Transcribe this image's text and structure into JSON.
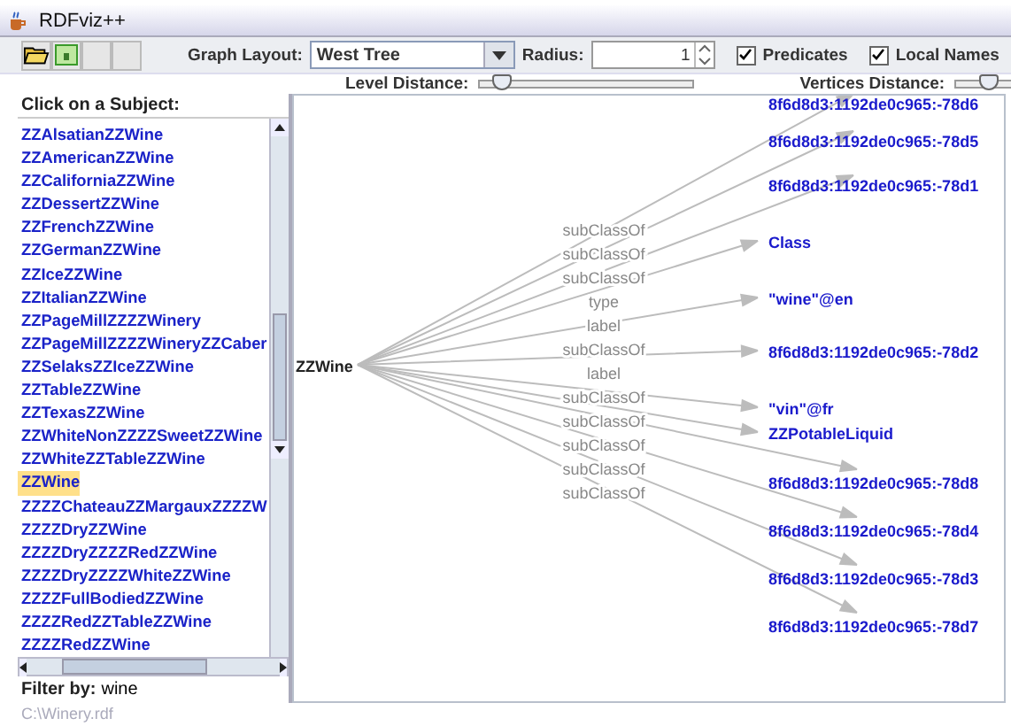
{
  "window": {
    "title": "RDFviz++"
  },
  "toolbar": {
    "graph_layout_label": "Graph Layout:",
    "graph_layout": "West Tree",
    "radius_label": "Radius:",
    "radius": "1",
    "options": [
      {
        "label": "Predicates",
        "checked": true
      },
      {
        "label": "Local Names",
        "checked": true
      }
    ]
  },
  "sliders": [
    {
      "label": "Level Distance:",
      "level": 0.1
    },
    {
      "label": "Vertices Distance:",
      "level": 0.15
    }
  ],
  "subjects": {
    "heading": "Click on a Subject:",
    "items": [
      {
        "label": "ZZAlsatianZZWine",
        "selected": false
      },
      {
        "label": "ZZAmericanZZWine",
        "selected": false
      },
      {
        "label": "ZZCaliforniaZZWine",
        "selected": false
      },
      {
        "label": "ZZDessertZZWine",
        "selected": false
      },
      {
        "label": "ZZFrenchZZWine",
        "selected": false
      },
      {
        "label": "ZZGermanZZWine",
        "selected": false
      },
      {
        "label": "ZZIceZZWine",
        "selected": false
      },
      {
        "label": "ZZItalianZZWine",
        "selected": false
      },
      {
        "label": "ZZPageMillZZZZWinery",
        "selected": false
      },
      {
        "label": "ZZPageMillZZZZWineryZZCaber",
        "selected": false
      },
      {
        "label": "ZZSelaksZZIceZZWine",
        "selected": false
      },
      {
        "label": "ZZTableZZWine",
        "selected": false
      },
      {
        "label": "ZZTexasZZWine",
        "selected": false
      },
      {
        "label": "ZZWhiteNonZZZZSweetZZWine",
        "selected": false
      },
      {
        "label": "ZZWhiteZZTableZZWine",
        "selected": false
      },
      {
        "label": "ZZWine",
        "selected": true
      },
      {
        "label": "ZZZZChateauZZMargauxZZZZW",
        "selected": false
      },
      {
        "label": "ZZZZDryZZWine",
        "selected": false
      },
      {
        "label": "ZZZZDryZZZZRedZZWine",
        "selected": false
      },
      {
        "label": "ZZZZDryZZZZWhiteZZWine",
        "selected": false
      },
      {
        "label": "ZZZZFullBodiedZZWine",
        "selected": false
      },
      {
        "label": "ZZZZRedZZTableZZWine",
        "selected": false
      },
      {
        "label": "ZZZZRedZZWine",
        "selected": false
      }
    ],
    "filter_label": "Filter by:",
    "filter": "wine"
  },
  "graph": {
    "root": "ZZWine",
    "edges": [
      {
        "predicate": "subClassOf",
        "object": "8f6d8d3:1192de0c965:-78d6"
      },
      {
        "predicate": "subClassOf",
        "object": "8f6d8d3:1192de0c965:-78d5"
      },
      {
        "predicate": "subClassOf",
        "object": "8f6d8d3:1192de0c965:-78d1"
      },
      {
        "predicate": "type",
        "object": "Class"
      },
      {
        "predicate": "label",
        "object": "\"wine\"@en"
      },
      {
        "predicate": "subClassOf",
        "object": "8f6d8d3:1192de0c965:-78d2"
      },
      {
        "predicate": "label",
        "object": "\"vin\"@fr"
      },
      {
        "predicate": "subClassOf",
        "object": "ZZPotableLiquid"
      },
      {
        "predicate": "subClassOf",
        "object": "8f6d8d3:1192de0c965:-78d8"
      },
      {
        "predicate": "subClassOf",
        "object": "8f6d8d3:1192de0c965:-78d4"
      },
      {
        "predicate": "subClassOf",
        "object": "8f6d8d3:1192de0c965:-78d3"
      },
      {
        "predicate": "subClassOf",
        "object": "8f6d8d3:1192de0c965:-78d7"
      }
    ]
  },
  "status_bar": "C:\\Winery.rdf"
}
